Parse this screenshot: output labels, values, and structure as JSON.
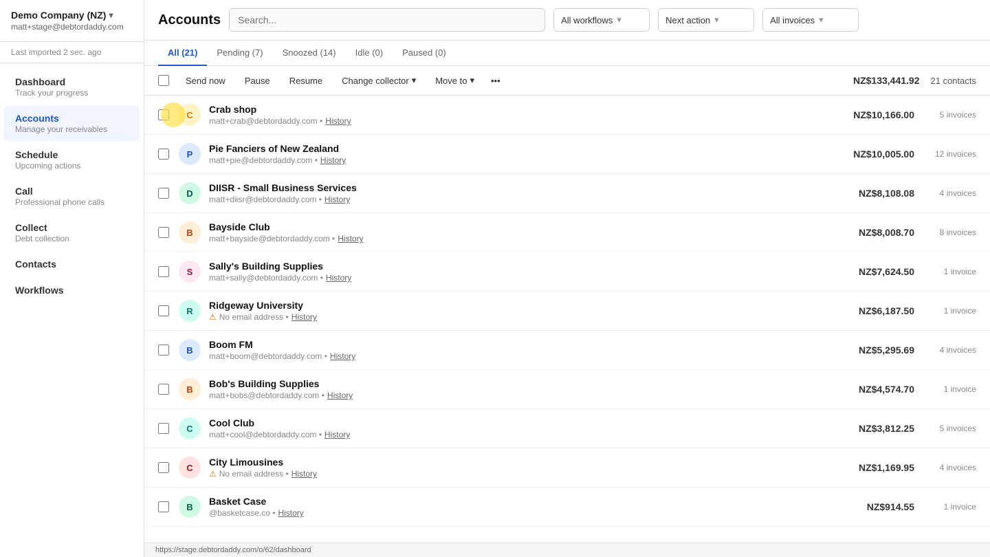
{
  "sidebar": {
    "company": "Demo Company (NZ)",
    "chevron": "▾",
    "email": "matt+stage@debtordaddy.com",
    "import_status": "Last imported 2 sec. ago",
    "nav_items": [
      {
        "id": "dashboard",
        "title": "Dashboard",
        "sub": "Track your progress",
        "active": false
      },
      {
        "id": "accounts",
        "title": "Accounts",
        "sub": "Manage your receivables",
        "active": true
      },
      {
        "id": "schedule",
        "title": "Schedule",
        "sub": "Upcoming actions",
        "active": false
      },
      {
        "id": "call",
        "title": "Call",
        "sub": "Professional phone calls",
        "active": false
      },
      {
        "id": "collect",
        "title": "Collect",
        "sub": "Debt collection",
        "active": false
      },
      {
        "id": "contacts",
        "title": "Contacts",
        "sub": "",
        "active": false
      },
      {
        "id": "workflows",
        "title": "Workflows",
        "sub": "",
        "active": false
      }
    ]
  },
  "topbar": {
    "title": "Accounts",
    "search_placeholder": "Search...",
    "filters": [
      {
        "id": "workflows",
        "label": "All workflows",
        "chevron": "▾"
      },
      {
        "id": "next_action",
        "label": "Next action",
        "chevron": "▾"
      },
      {
        "id": "invoices",
        "label": "All invoices",
        "chevron": "▾"
      }
    ]
  },
  "tabs": [
    {
      "id": "all",
      "label": "All (21)",
      "active": true
    },
    {
      "id": "pending",
      "label": "Pending (7)",
      "active": false
    },
    {
      "id": "snoozed",
      "label": "Snoozed (14)",
      "active": false
    },
    {
      "id": "idle",
      "label": "Idle (0)",
      "active": false
    },
    {
      "id": "paused",
      "label": "Paused (0)",
      "active": false
    }
  ],
  "toolbar": {
    "send_now": "Send now",
    "pause": "Pause",
    "resume": "Resume",
    "change_collector": "Change collector",
    "change_collector_chevron": "▾",
    "move_to": "Move to",
    "move_to_chevron": "▾",
    "more": "•••",
    "total": "NZ$133,441.92",
    "contacts": "21 contacts"
  },
  "accounts": [
    {
      "id": "crab-shop",
      "name": "Crab shop",
      "email": "matt+crab@debtordaddy.com",
      "avatar_char": "C",
      "avatar_color": "yellow",
      "amount": "NZ$10,166.00",
      "invoices": "5 invoices",
      "has_highlight": true
    },
    {
      "id": "pie-fanciers",
      "name": "Pie Fanciers of New Zealand",
      "email": "matt+pie@debtordaddy.com",
      "avatar_char": "P",
      "avatar_color": "blue",
      "amount": "NZ$10,005.00",
      "invoices": "12 invoices",
      "has_highlight": false
    },
    {
      "id": "diisr",
      "name": "DIISR - Small Business Services",
      "email": "matt+diisr@debtordaddy.com",
      "avatar_char": "D",
      "avatar_color": "green",
      "amount": "NZ$8,108.08",
      "invoices": "4 invoices",
      "has_highlight": false
    },
    {
      "id": "bayside-club",
      "name": "Bayside Club",
      "email": "matt+bayside@debtordaddy.com",
      "avatar_char": "B",
      "avatar_color": "orange",
      "amount": "NZ$8,008.70",
      "invoices": "8 invoices",
      "has_highlight": false
    },
    {
      "id": "sallys-building",
      "name": "Sally's Building Supplies",
      "email": "matt+sally@debtordaddy.com",
      "avatar_char": "S",
      "avatar_color": "pink",
      "amount": "NZ$7,624.50",
      "invoices": "1 invoice",
      "has_highlight": false
    },
    {
      "id": "ridgeway-university",
      "name": "Ridgeway University",
      "email": "",
      "no_email": true,
      "avatar_char": "R",
      "avatar_color": "teal",
      "amount": "NZ$6,187.50",
      "invoices": "1 invoice",
      "has_highlight": false
    },
    {
      "id": "boom-fm",
      "name": "Boom FM",
      "email": "matt+boom@debtordaddy.com",
      "avatar_char": "B",
      "avatar_color": "blue",
      "amount": "NZ$5,295.69",
      "invoices": "4 invoices",
      "has_highlight": false
    },
    {
      "id": "bobs-building",
      "name": "Bob's Building Supplies",
      "email": "matt+bobs@debtordaddy.com",
      "avatar_char": "B",
      "avatar_color": "orange",
      "amount": "NZ$4,574.70",
      "invoices": "1 invoice",
      "has_highlight": false
    },
    {
      "id": "cool-club",
      "name": "Cool Club",
      "email": "matt+cool@debtordaddy.com",
      "avatar_char": "C",
      "avatar_color": "teal",
      "amount": "NZ$3,812.25",
      "invoices": "5 invoices",
      "has_highlight": false
    },
    {
      "id": "city-limousines",
      "name": "City Limousines",
      "email": "",
      "no_email": true,
      "avatar_char": "C",
      "avatar_color": "red",
      "amount": "NZ$1,169.95",
      "invoices": "4 invoices",
      "has_highlight": false
    },
    {
      "id": "basket-case",
      "name": "Basket Case",
      "email": "@basketcase.co",
      "avatar_char": "B",
      "avatar_color": "green",
      "amount": "NZ$914.55",
      "invoices": "1 invoice",
      "has_highlight": false
    }
  ],
  "status_bar": {
    "url": "https://stage.debtordaddy.com/o/62/dashboard"
  }
}
